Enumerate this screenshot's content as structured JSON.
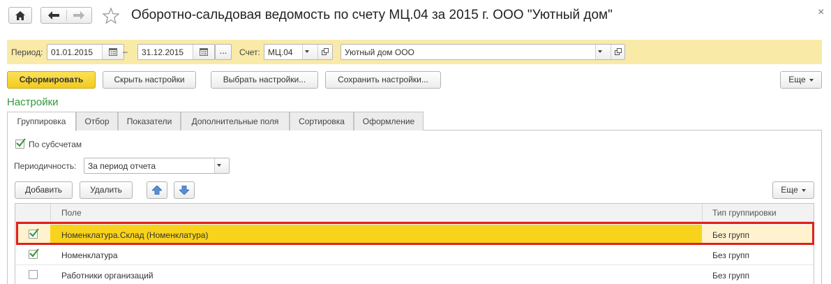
{
  "header": {
    "title": "Оборотно-сальдовая ведомость по счету МЦ.04 за 2015 г. ООО \"Уютный дом\""
  },
  "params": {
    "period_label": "Период:",
    "date_from": "01.01.2015",
    "dash": "–",
    "date_to": "31.12.2015",
    "dots": "...",
    "account_label": "Счет:",
    "account_value": "МЦ.04",
    "org_value": "Уютный дом ООО"
  },
  "toolbar": {
    "generate": "Сформировать",
    "hide_settings": "Скрыть настройки",
    "choose_settings": "Выбрать настройки...",
    "save_settings": "Сохранить настройки...",
    "more": "Еще"
  },
  "settings": {
    "title": "Настройки",
    "tabs": [
      "Группировка",
      "Отбор",
      "Показатели",
      "Дополнительные поля",
      "Сортировка",
      "Оформление"
    ],
    "active_tab": 0
  },
  "grouping": {
    "by_subaccounts_label": "По субсчетам",
    "by_subaccounts_checked": true,
    "periodicity_label": "Периодичность:",
    "periodicity_value": "За период отчета",
    "add": "Добавить",
    "delete": "Удалить",
    "more": "Еще"
  },
  "grid": {
    "columns": [
      "Поле",
      "Тип группировки"
    ],
    "rows": [
      {
        "checked": true,
        "field": "Номенклатура.Склад (Номенклатура)",
        "type": "Без групп",
        "selected": true
      },
      {
        "checked": true,
        "field": "Номенклатура",
        "type": "Без групп",
        "selected": false
      },
      {
        "checked": false,
        "field": "Работники организаций",
        "type": "Без групп",
        "selected": false
      }
    ]
  },
  "colors": {
    "accent_yellow": "#f8d31c",
    "param_bar_bg": "#f9eaa7",
    "settings_title_green": "#2f9a3a",
    "highlight_red": "#e0201f",
    "check_green": "#3a9a3a"
  }
}
